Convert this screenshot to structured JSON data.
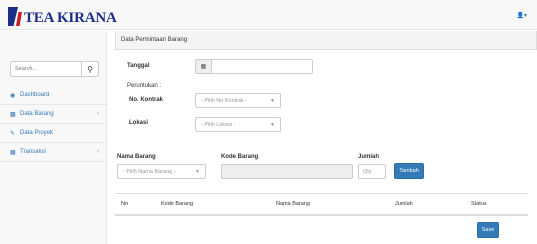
{
  "brand": {
    "name": "TEA KIRANA"
  },
  "user_menu": {
    "icon": "user-icon",
    "caret": "▾"
  },
  "sidebar": {
    "search": {
      "placeholder": "Search..."
    },
    "items": [
      {
        "label": "Dashboard",
        "icon": "dashboard-icon"
      },
      {
        "label": "Data Barang",
        "icon": "bar-chart-icon",
        "has_submenu": true
      },
      {
        "label": "Data Proyek",
        "icon": "edit-icon"
      },
      {
        "label": "Transaksi",
        "icon": "table-icon",
        "has_submenu": true
      }
    ]
  },
  "panel": {
    "title": "Data Permintaan Barang"
  },
  "form": {
    "tanggal_label": "Tanggal",
    "peruntukan_label": "Peruntukan :",
    "kontrak_label": "No. Kontrak",
    "kontrak_placeholder": "- Pilih No Kontrak -",
    "lokasi_label": "Lokasi",
    "lokasi_placeholder": "- Pilih Lokasi -",
    "nama_barang_label": "Nama Barang",
    "nama_barang_placeholder": "- Pilih Nama Barang -",
    "kode_barang_label": "Kode Barang",
    "jumlah_label": "Jumlah",
    "jumlah_placeholder": "Qty",
    "tambah_label": "Tambah"
  },
  "table": {
    "columns": [
      "No",
      "Kode Barang",
      "Nama Barang",
      "Jumlah",
      "Status"
    ]
  },
  "save_label": "Save",
  "colors": {
    "brand_blue": "#1b2f8a",
    "brand_red": "#c8202a",
    "link": "#337ab7",
    "primary": "#337ab7"
  }
}
